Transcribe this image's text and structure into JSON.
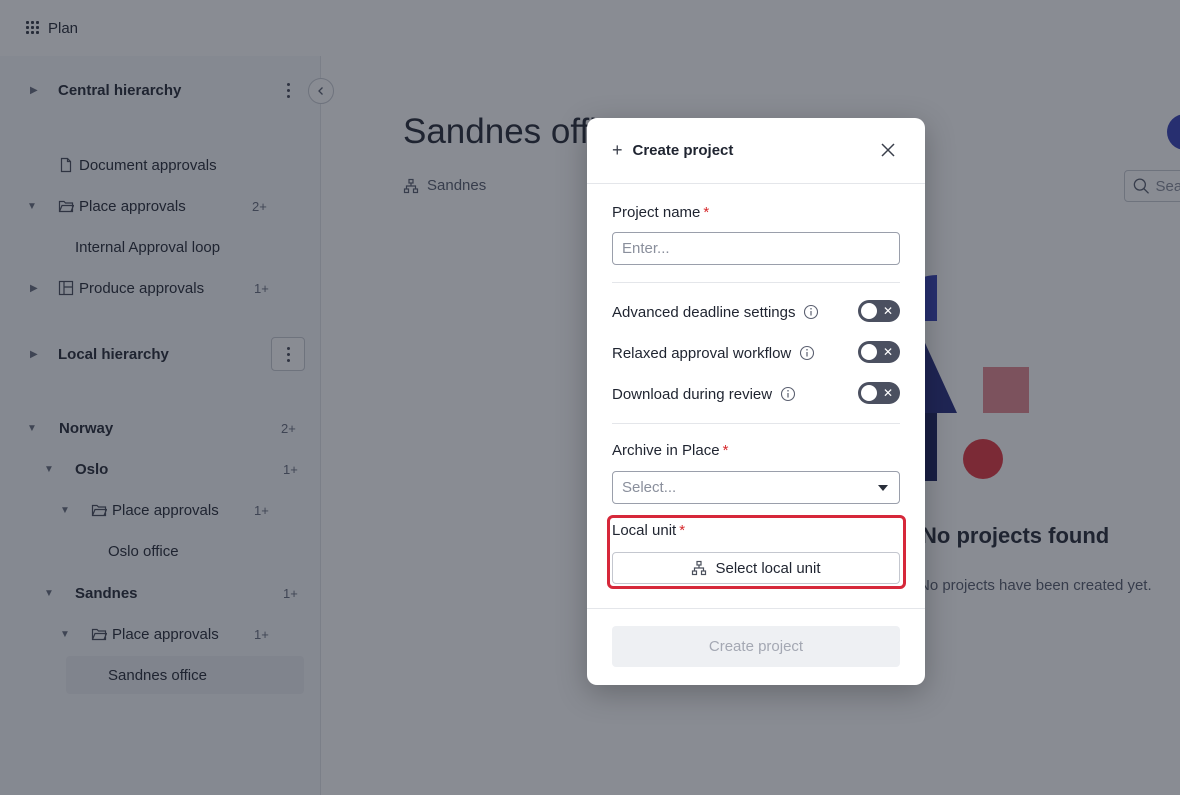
{
  "app": {
    "title": "Plan"
  },
  "sidebar": {
    "rows": [
      {
        "label": "Central hierarchy",
        "count": ""
      },
      {
        "label": "Document approvals",
        "count": ""
      },
      {
        "label": "Place approvals",
        "count": "2+"
      },
      {
        "label": "Internal Approval loop",
        "count": ""
      },
      {
        "label": "Produce approvals",
        "count": "1+"
      },
      {
        "label": "Local hierarchy",
        "count": ""
      },
      {
        "label": "Norway",
        "count": "2+"
      },
      {
        "label": "Oslo",
        "count": "1+"
      },
      {
        "label": "Place approvals",
        "count": "1+"
      },
      {
        "label": "Oslo office",
        "count": ""
      },
      {
        "label": "Sandnes",
        "count": "1+"
      },
      {
        "label": "Place approvals",
        "count": "1+"
      },
      {
        "label": "Sandnes office",
        "count": ""
      }
    ]
  },
  "main": {
    "title": "Sandnes office",
    "location": "Sandnes",
    "search_placeholder": "Search",
    "empty_title": "No projects found",
    "empty_desc": "No projects have been created yet."
  },
  "modal": {
    "title": "Create project",
    "project_name_label": "Project name",
    "required_mark": "*",
    "project_name_placeholder": "Enter...",
    "toggles": [
      {
        "label": "Advanced deadline settings",
        "on": false
      },
      {
        "label": "Relaxed approval workflow",
        "on": false
      },
      {
        "label": "Download during review",
        "on": false
      }
    ],
    "toggle_off_glyph": "✕",
    "archive_label": "Archive in Place",
    "archive_placeholder": "Select...",
    "local_unit_label": "Local unit",
    "select_local_unit": "Select local unit",
    "create_button": "Create project"
  },
  "colors": {
    "accent": "#3a44b8",
    "required": "#d6282b",
    "highlight": "#d6283a",
    "toggle_off": "#4b5060"
  }
}
